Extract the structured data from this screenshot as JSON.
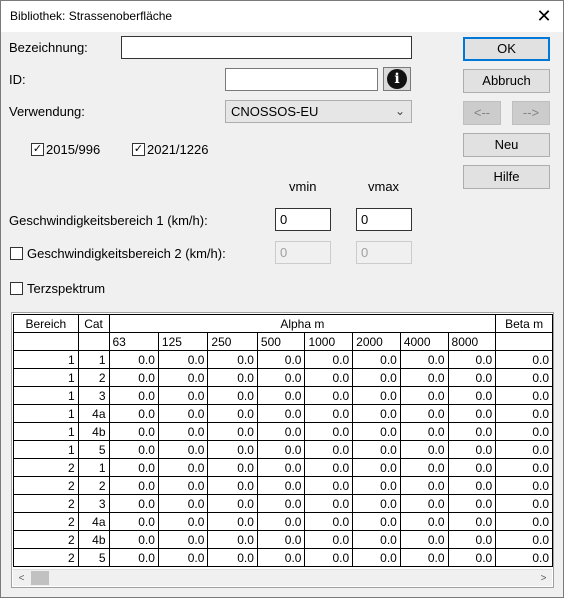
{
  "window": {
    "title": "Bibliothek: Strassenoberfläche",
    "close_glyph": "✕"
  },
  "form": {
    "bezeichnung_label": "Bezeichnung:",
    "bezeichnung_value": "",
    "id_label": "ID:",
    "id_value": "",
    "verwendung_label": "Verwendung:",
    "verwendung_value": "CNOSSOS-EU",
    "check_2015_label": "2015/996",
    "check_2015_checked": true,
    "check_2021_label": "2021/1226",
    "check_2021_checked": true,
    "vmin_label": "vmin",
    "vmax_label": "vmax",
    "speed1_label": "Geschwindigkeitsbereich 1 (km/h):",
    "speed1_vmin": "0",
    "speed1_vmax": "0",
    "speed2_label": "Geschwindigkeitsbereich 2 (km/h):",
    "speed2_checked": false,
    "speed2_vmin": "0",
    "speed2_vmax": "0",
    "terz_label": "Terzspektrum",
    "terz_checked": false
  },
  "buttons": {
    "ok": "OK",
    "abbruch": "Abbruch",
    "prev": "<--",
    "next": "-->",
    "neu": "Neu",
    "hilfe": "Hilfe"
  },
  "table": {
    "headers": {
      "bereich": "Bereich",
      "cat": "Cat",
      "alpha": "Alpha m",
      "beta": "Beta m"
    },
    "freqs": [
      "63",
      "125",
      "250",
      "500",
      "1000",
      "2000",
      "4000",
      "8000"
    ],
    "rows": [
      {
        "bereich": "1",
        "cat": "1",
        "alpha": [
          "0.0",
          "0.0",
          "0.0",
          "0.0",
          "0.0",
          "0.0",
          "0.0",
          "0.0"
        ],
        "beta": "0.0"
      },
      {
        "bereich": "1",
        "cat": "2",
        "alpha": [
          "0.0",
          "0.0",
          "0.0",
          "0.0",
          "0.0",
          "0.0",
          "0.0",
          "0.0"
        ],
        "beta": "0.0"
      },
      {
        "bereich": "1",
        "cat": "3",
        "alpha": [
          "0.0",
          "0.0",
          "0.0",
          "0.0",
          "0.0",
          "0.0",
          "0.0",
          "0.0"
        ],
        "beta": "0.0"
      },
      {
        "bereich": "1",
        "cat": "4a",
        "alpha": [
          "0.0",
          "0.0",
          "0.0",
          "0.0",
          "0.0",
          "0.0",
          "0.0",
          "0.0"
        ],
        "beta": "0.0"
      },
      {
        "bereich": "1",
        "cat": "4b",
        "alpha": [
          "0.0",
          "0.0",
          "0.0",
          "0.0",
          "0.0",
          "0.0",
          "0.0",
          "0.0"
        ],
        "beta": "0.0"
      },
      {
        "bereich": "1",
        "cat": "5",
        "alpha": [
          "0.0",
          "0.0",
          "0.0",
          "0.0",
          "0.0",
          "0.0",
          "0.0",
          "0.0"
        ],
        "beta": "0.0"
      },
      {
        "bereich": "2",
        "cat": "1",
        "alpha": [
          "0.0",
          "0.0",
          "0.0",
          "0.0",
          "0.0",
          "0.0",
          "0.0",
          "0.0"
        ],
        "beta": "0.0"
      },
      {
        "bereich": "2",
        "cat": "2",
        "alpha": [
          "0.0",
          "0.0",
          "0.0",
          "0.0",
          "0.0",
          "0.0",
          "0.0",
          "0.0"
        ],
        "beta": "0.0"
      },
      {
        "bereich": "2",
        "cat": "3",
        "alpha": [
          "0.0",
          "0.0",
          "0.0",
          "0.0",
          "0.0",
          "0.0",
          "0.0",
          "0.0"
        ],
        "beta": "0.0"
      },
      {
        "bereich": "2",
        "cat": "4a",
        "alpha": [
          "0.0",
          "0.0",
          "0.0",
          "0.0",
          "0.0",
          "0.0",
          "0.0",
          "0.0"
        ],
        "beta": "0.0"
      },
      {
        "bereich": "2",
        "cat": "4b",
        "alpha": [
          "0.0",
          "0.0",
          "0.0",
          "0.0",
          "0.0",
          "0.0",
          "0.0",
          "0.0"
        ],
        "beta": "0.0"
      },
      {
        "bereich": "2",
        "cat": "5",
        "alpha": [
          "0.0",
          "0.0",
          "0.0",
          "0.0",
          "0.0",
          "0.0",
          "0.0",
          "0.0"
        ],
        "beta": "0.0"
      }
    ]
  },
  "scrollbar": {
    "left_arrow": "<",
    "right_arrow": ">"
  },
  "icons": {
    "info": "info-icon",
    "close": "close-icon",
    "dropdown": "chevron-down-icon"
  }
}
